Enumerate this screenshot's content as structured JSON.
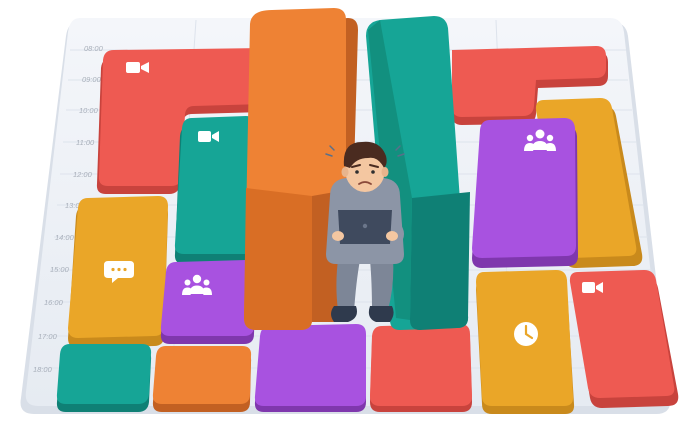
{
  "calendar": {
    "times": [
      "08:00",
      "09:00",
      "10:00",
      "11:00",
      "12:00",
      "13:00",
      "14:00",
      "15:00",
      "16:00",
      "17:00",
      "18:00"
    ]
  },
  "colors": {
    "board": "#eef2f7",
    "red": "#ee5a52",
    "orange": "#ee8234",
    "teal": "#16a596",
    "yellow": "#eaa628",
    "purple": "#a852e0",
    "skin": "#f4c7a1",
    "hoodie": "#8c95a6",
    "hair": "#4a2b20"
  },
  "icons": {
    "video": "video-camera-icon",
    "group": "people-group-icon",
    "chat": "chat-bubble-icon",
    "clock": "clock-icon"
  },
  "scene": {
    "character": "stressed-person-with-laptop"
  }
}
